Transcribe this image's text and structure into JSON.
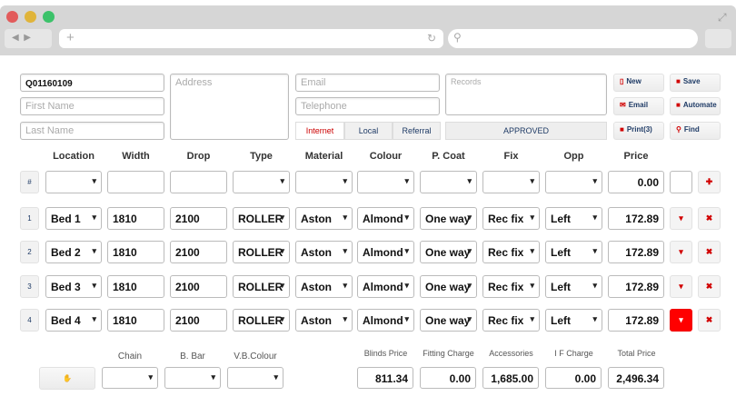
{
  "header": {
    "quote_no": "Q01160109",
    "first_name_ph": "First Name",
    "last_name_ph": "Last Name",
    "address_ph": "Address",
    "email_ph": "Email",
    "telephone_ph": "Telephone",
    "records_ph": "Records",
    "status": "APPROVED",
    "tabs": [
      "Internet",
      "Local",
      "Referral"
    ],
    "buttons": [
      "New",
      "Save",
      "Email",
      "Automate",
      "Print(3)",
      "Find"
    ]
  },
  "columns": [
    "Location",
    "Width",
    "Drop",
    "Type",
    "Material",
    "Colour",
    "P. Coat",
    "Fix",
    "Opp",
    "Price"
  ],
  "new_row": {
    "marker": "#",
    "price": "0.00"
  },
  "rows": [
    {
      "n": "1",
      "location": "Bed 1",
      "width": "1810",
      "drop": "2100",
      "type": "ROLLER",
      "material": "Aston",
      "colour": "Almond",
      "pcoat": "One way",
      "fix": "Rec fix",
      "opp": "Left",
      "price": "172.89"
    },
    {
      "n": "2",
      "location": "Bed 2",
      "width": "1810",
      "drop": "2100",
      "type": "ROLLER",
      "material": "Aston",
      "colour": "Almond",
      "pcoat": "One way",
      "fix": "Rec fix",
      "opp": "Left",
      "price": "172.89"
    },
    {
      "n": "3",
      "location": "Bed 3",
      "width": "1810",
      "drop": "2100",
      "type": "ROLLER",
      "material": "Aston",
      "colour": "Almond",
      "pcoat": "One way",
      "fix": "Rec fix",
      "opp": "Left",
      "price": "172.89"
    },
    {
      "n": "4",
      "location": "Bed 4",
      "width": "1810",
      "drop": "2100",
      "type": "ROLLER",
      "material": "Aston",
      "colour": "Almond",
      "pcoat": "One way",
      "fix": "Rec fix",
      "opp": "Left",
      "price": "172.89"
    }
  ],
  "footer": {
    "selects": [
      "Chain",
      "B. Bar",
      "V.B.Colour"
    ],
    "totals": [
      {
        "label": "Blinds Price",
        "value": "811.34"
      },
      {
        "label": "Fitting Charge",
        "value": "0.00"
      },
      {
        "label": "Accessories",
        "value": "1,685.00"
      },
      {
        "label": "I F Charge",
        "value": "0.00"
      },
      {
        "label": "Total Price",
        "value": "2,496.34"
      }
    ]
  },
  "colors": {
    "accent": "#d10000",
    "active_row_button": "#ff0000"
  }
}
